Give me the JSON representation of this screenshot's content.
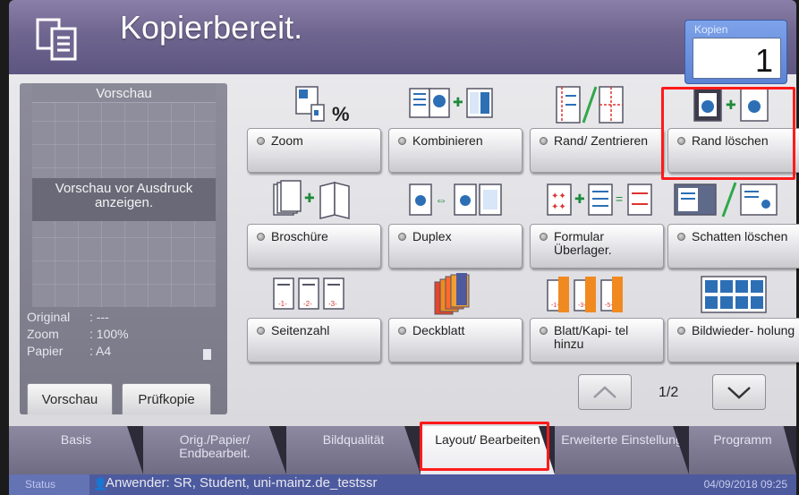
{
  "header": {
    "title": "Kopierbereit.",
    "copies_label": "Kopien",
    "copies_value": "1"
  },
  "preview": {
    "title": "Vorschau",
    "message": "Vorschau vor Ausdruck anzeigen.",
    "info": [
      {
        "key": "Original",
        "value": ": ---"
      },
      {
        "key": "Zoom",
        "value": ": 100%"
      },
      {
        "key": "Papier",
        "value": ": A4"
      }
    ],
    "preview_button": "Vorschau",
    "testcopy_button": "Prüfkopie"
  },
  "functions": [
    {
      "label": "Zoom",
      "icon": "zoom-icon"
    },
    {
      "label": "Kombinieren",
      "icon": "combine-icon"
    },
    {
      "label": "Rand/ Zentrieren",
      "icon": "margin-center-icon"
    },
    {
      "label": "Rand löschen",
      "icon": "border-erase-icon"
    },
    {
      "label": "Broschüre",
      "icon": "booklet-icon"
    },
    {
      "label": "Duplex",
      "icon": "duplex-icon"
    },
    {
      "label": "Formular Überlager.",
      "icon": "form-overlay-icon"
    },
    {
      "label": "Schatten löschen",
      "icon": "shadow-erase-icon"
    },
    {
      "label": "Seitenzahl",
      "icon": "page-number-icon"
    },
    {
      "label": "Deckblatt",
      "icon": "cover-icon"
    },
    {
      "label": "Blatt/Kapi- tel hinzu",
      "icon": "insert-sheet-icon"
    },
    {
      "label": "Bildwieder- holung",
      "icon": "image-repeat-icon"
    }
  ],
  "pager": {
    "text": "1/2"
  },
  "tabs": [
    {
      "label": "Basis",
      "active": false
    },
    {
      "label": "Orig./Papier/ Endbearbeit.",
      "active": false
    },
    {
      "label": "Bildqualität",
      "active": false
    },
    {
      "label": "Layout/ Bearbeiten",
      "active": true
    },
    {
      "label": "Erweiterte Einstellung",
      "active": false
    },
    {
      "label": "Programm",
      "active": false
    }
  ],
  "status": {
    "label": "Status",
    "user": "Anwender: SR, Student, uni-mainz.de_testssr",
    "datetime": "04/09/2018  09:25"
  },
  "colors": {
    "highlight": "#ff1a1a",
    "header": "#6f6690",
    "copies": "#5c82d4"
  }
}
